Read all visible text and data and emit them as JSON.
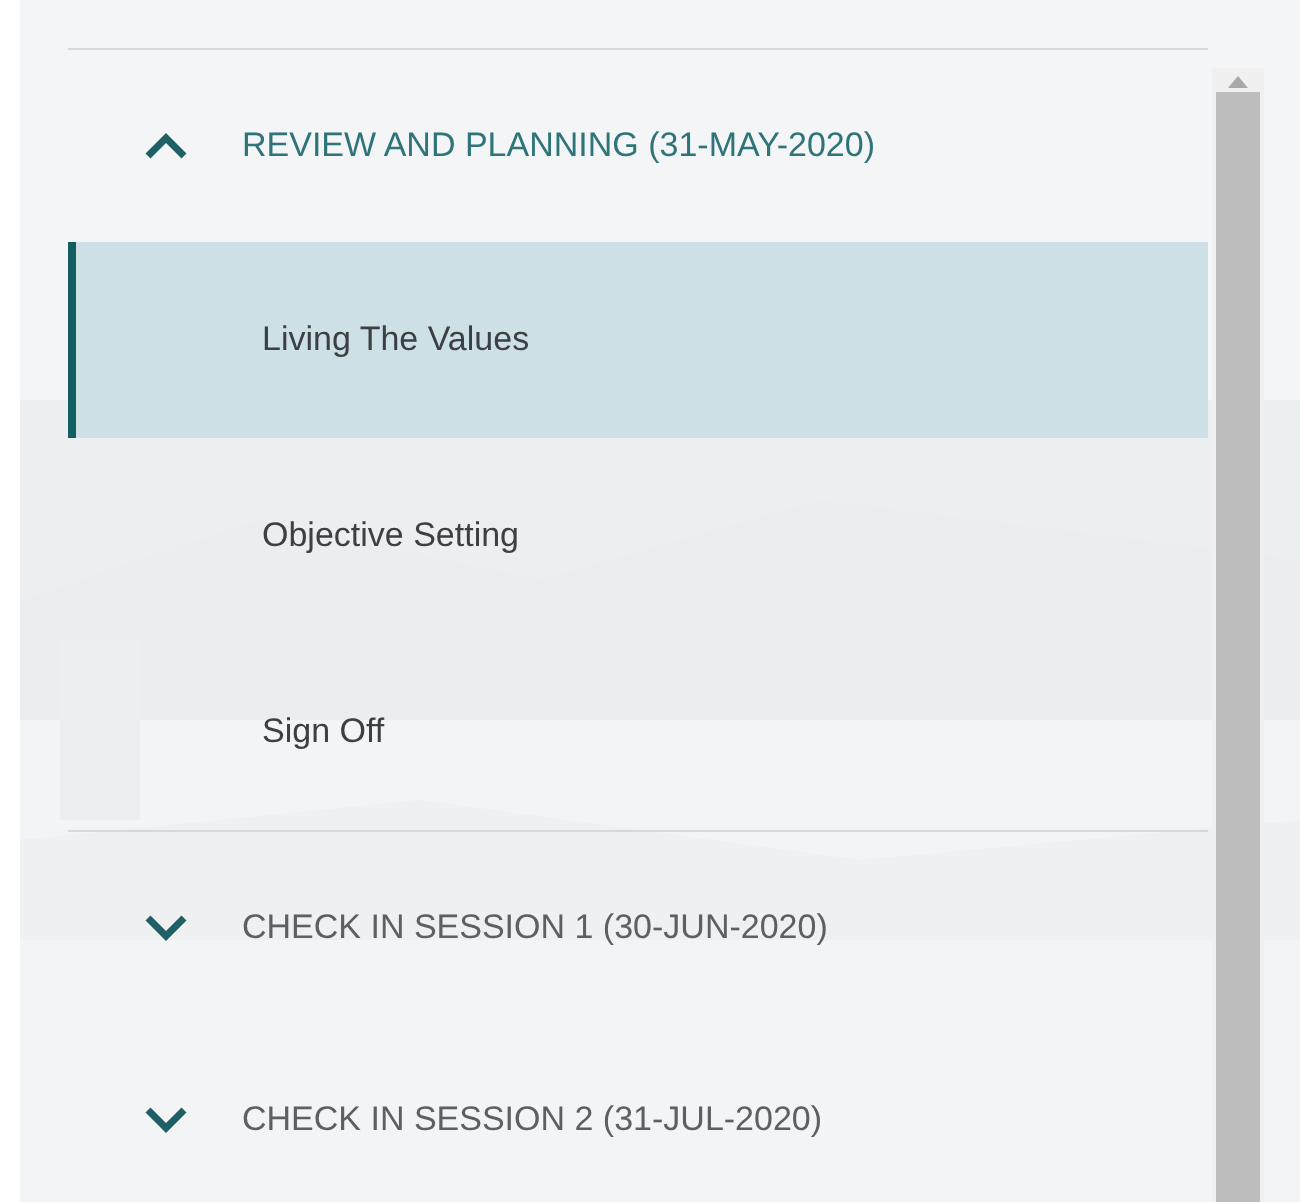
{
  "sections": [
    {
      "title": "REVIEW AND PLANNING (31-MAY-2020)",
      "expanded": true,
      "items": [
        {
          "label": "Living The Values",
          "selected": true
        },
        {
          "label": "Objective Setting",
          "selected": false
        },
        {
          "label": "Sign Off",
          "selected": false
        }
      ]
    },
    {
      "title": "CHECK IN SESSION 1 (30-JUN-2020)",
      "expanded": false
    },
    {
      "title": "CHECK IN SESSION 2 (31-JUL-2020)",
      "expanded": false
    }
  ]
}
